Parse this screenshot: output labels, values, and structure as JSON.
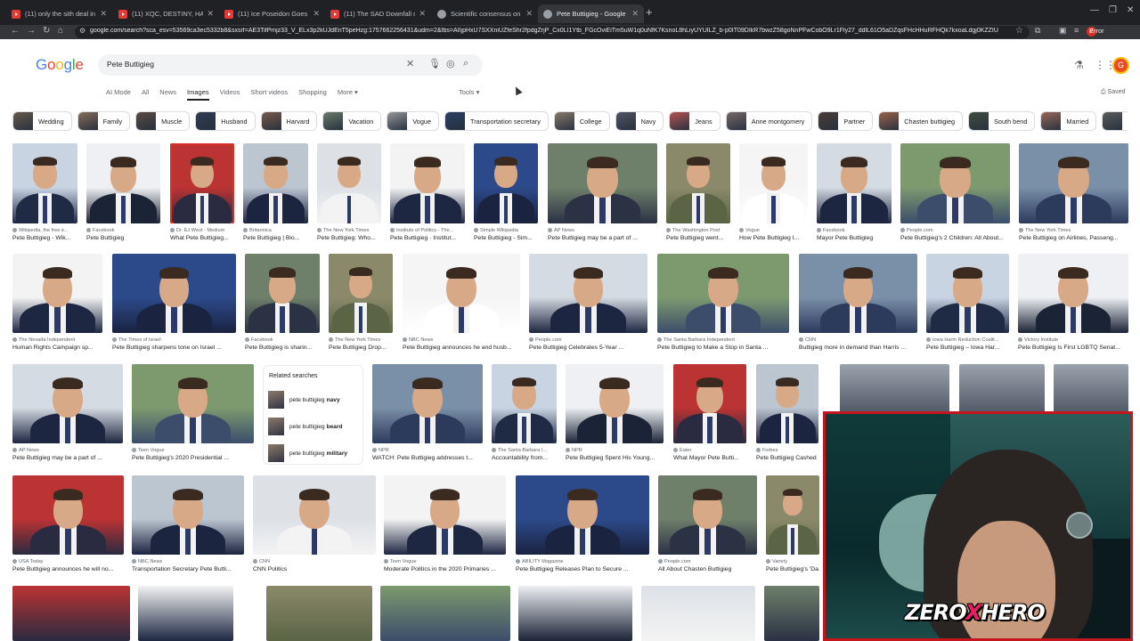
{
  "browser": {
    "tabs": [
      {
        "title": "(11) only the sith deal in absolu",
        "icon": "youtube-icon"
      },
      {
        "title": "(11) XQC, DESTINY, HASAN, AN",
        "icon": "youtube-icon"
      },
      {
        "title": "(11) Ice Poseidon Goes On a Cr",
        "icon": "youtube-icon"
      },
      {
        "title": "(11) The SAD Downfall of Justin",
        "icon": "youtube-icon"
      },
      {
        "title": "Scientific consensus on race IQ",
        "icon": "globe-icon"
      },
      {
        "title": "Pete Buttigieg - Google Search",
        "icon": "google-icon",
        "active": true
      }
    ],
    "url": "google.com/search?sca_esv=53569ca3ec5332b8&sxsrf=AE3TifPmjz33_V_ELx3p2kUJdEnT5peHzg:1757662256431&udm=2&fbs=AIIjpHxU7SXXniUZfeShr2fpdgZrjP_Cx0LI1Ytb_FGcOviEiTm5uW1q0uNfK7KsnoL8hLiyUYUILZ_b-p0IT09DIkR7bwzZ58goNnPFwCobO9Lr1Fly27_ddlL61O5aDZqsFHcHHuRFHQk7kxoaLdgj0KZZIU_IDUonyMsH",
    "profile_badge": "2",
    "error_label": "Error"
  },
  "search": {
    "logo": [
      "G",
      "o",
      "o",
      "g",
      "l",
      "e"
    ],
    "logo_colors": [
      "#4285f4",
      "#ea4335",
      "#fbbc05",
      "#4285f4",
      "#34a853",
      "#ea4335"
    ],
    "query": "Pete Buttigieg",
    "avatar_letter": "G"
  },
  "nav_tabs": [
    "AI Mode",
    "All",
    "News",
    "Images",
    "Videos",
    "Short videos",
    "Shopping",
    "More ▾"
  ],
  "active_tab": "Images",
  "tools_label": "Tools ▾",
  "saved_label": "Saved",
  "chips": [
    "Wedding",
    "Family",
    "Muscle",
    "Husband",
    "Harvard",
    "Vacation",
    "Vogue",
    "Transportation secretary",
    "College",
    "Navy",
    "Jeans",
    "Anne montgomery",
    "Partner",
    "Chasten buttigieg",
    "South bend",
    "Married",
    "Constru"
  ],
  "rows": [
    [
      {
        "src": "Wikipedia, the free e...",
        "cap": "Pete Buttigieg - Wik..."
      },
      {
        "src": "Facebook",
        "cap": "Pete Buttigieg"
      },
      {
        "src": "Dr. EJ West - Medium",
        "cap": "What Pete Buttigieg..."
      },
      {
        "src": "Britannica",
        "cap": "Pete Buttigieg | Bio..."
      },
      {
        "src": "The New York Times",
        "cap": "Pete Buttigieg: Who..."
      },
      {
        "src": "Institute of Politics - The...",
        "cap": "Pete Buttigieg · Institut..."
      },
      {
        "src": "Simple Wikipedia",
        "cap": "Pete Buttigieg - Sim..."
      },
      {
        "src": "AP News",
        "cap": "Pete Buttigieg may be a part of ..."
      },
      {
        "src": "The Washington Post",
        "cap": "Pete Buttigieg went..."
      },
      {
        "src": "Vogue",
        "cap": "How Pete Buttigieg I..."
      },
      {
        "src": "Facebook",
        "cap": "Mayor Pete Buttigieg"
      },
      {
        "src": "People.com",
        "cap": "Pete Buttigieg's 2 Children: All About..."
      },
      {
        "src": "The New York Times",
        "cap": "Pete Buttigieg on Airlines, Passeng..."
      }
    ],
    [
      {
        "src": "The Nevada Independent",
        "cap": "Human Rights Campaign sp..."
      },
      {
        "src": "The Times of Israel",
        "cap": "Pete Buttigieg sharpens tone on Israel ..."
      },
      {
        "src": "Facebook",
        "cap": "Pete Buttigieg is sharin..."
      },
      {
        "src": "The New York Times",
        "cap": "Pete Buttigieg Drop..."
      },
      {
        "src": "NBC News",
        "cap": "Pete Buttigieg announces he and husb..."
      },
      {
        "src": "People.com",
        "cap": "Pete Buttigieg Celebrates 5-Year ..."
      },
      {
        "src": "The Santa Barbara Independent",
        "cap": "Pete Buttigieg to Make a Stop in Santa ..."
      },
      {
        "src": "CNN",
        "cap": "Buttigieg more in demand than Harris ..."
      },
      {
        "src": "Iowa Harm Reduction Coalit...",
        "cap": "Pete Buttigieg – Iowa Har..."
      },
      {
        "src": "Victory Institute",
        "cap": "Pete Buttigieg Is First LGBTQ Senat..."
      }
    ],
    [
      {
        "src": "AP News",
        "cap": "Pete Buttigieg may be a part of ..."
      },
      {
        "src": "Teen Vogue",
        "cap": "Pete Buttigieg's 2020 Presidential ..."
      },
      {
        "src": "NPR",
        "cap": "WATCH: Pete Buttigieg addresses t..."
      },
      {
        "src": "The Santa Barbara I...",
        "cap": "Accountability from..."
      },
      {
        "src": "NPR",
        "cap": "Pete Buttigieg Spent His Young..."
      },
      {
        "src": "Eater",
        "cap": "What Mayor Pete Butti..."
      },
      {
        "src": "Forbes",
        "cap": "Pete Buttigieg Cashed"
      }
    ],
    [
      {
        "src": "USA Today",
        "cap": "Pete Buttigieg announces he will no..."
      },
      {
        "src": "NBC News",
        "cap": "Transportation Secretary Pete Butti..."
      },
      {
        "src": "CNN",
        "cap": "CNN Politics"
      },
      {
        "src": "Teen Vogue",
        "cap": "Moderate Politics in the 2020 Primaries ..."
      },
      {
        "src": "ABILITY Magazine",
        "cap": "Pete Buttigieg Releases Plan to Secure ..."
      },
      {
        "src": "People.com",
        "cap": "All About Chasten Buttigieg"
      },
      {
        "src": "Variety",
        "cap": "Pete Buttigieg's 'Da..."
      }
    ]
  ],
  "related": {
    "title": "Related searches",
    "prefix": "pete buttigieg",
    "items": [
      "navy",
      "beard",
      "military"
    ]
  },
  "overlay": {
    "logo_left": "ZERO",
    "logo_x": "X",
    "logo_right": "HERO"
  }
}
